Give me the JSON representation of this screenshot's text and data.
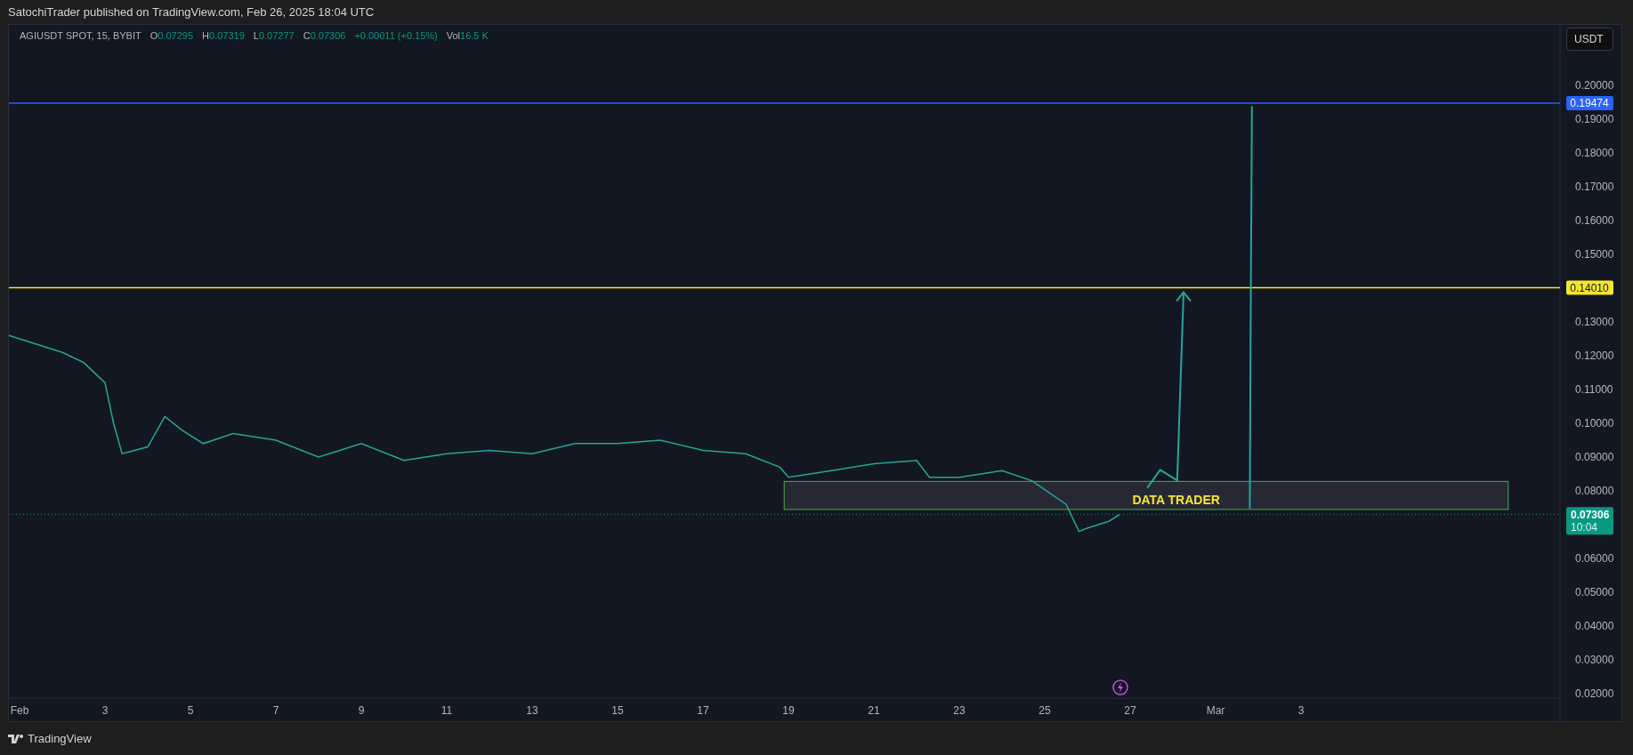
{
  "header": {
    "publish_note": "SatochiTrader published on TradingView.com, Feb 26, 2025 18:04 UTC"
  },
  "legend": {
    "symbol": "AGIUSDT SPOT, 15, BYBIT",
    "ohlc": [
      {
        "label": "O",
        "value": "0.07295"
      },
      {
        "label": "H",
        "value": "0.07319"
      },
      {
        "label": "L",
        "value": "0.07277"
      },
      {
        "label": "C",
        "value": "0.07306"
      }
    ],
    "change": "+0.00011 (+0.15%)",
    "volume": {
      "label": "Vol",
      "value": "16.5 K"
    }
  },
  "currency_button": "USDT",
  "chart": {
    "chart_data": {
      "type": "line",
      "x": [
        "2025-01-31T18:00",
        "2025-02-02T00:00",
        "2025-02-02T12:00",
        "2025-02-03T00:00",
        "2025-02-03T04:48",
        "2025-02-03T09:36",
        "2025-02-04T00:00",
        "2025-02-04T09:36",
        "2025-02-04T19:12",
        "2025-02-05T07:12",
        "2025-02-06T00:00",
        "2025-02-07T00:00",
        "2025-02-08T00:00",
        "2025-02-09T00:00",
        "2025-02-10T00:00",
        "2025-02-11T00:00",
        "2025-02-12T00:00",
        "2025-02-13T00:00",
        "2025-02-14T00:00",
        "2025-02-15T00:00",
        "2025-02-16T00:00",
        "2025-02-17T00:00",
        "2025-02-18T00:00",
        "2025-02-18T19:12",
        "2025-02-19T00:00",
        "2025-02-20T00:00",
        "2025-02-21T00:00",
        "2025-02-22T00:00",
        "2025-02-22T07:12",
        "2025-02-23T00:00",
        "2025-02-24T00:00",
        "2025-02-24T16:48",
        "2025-02-25T12:00",
        "2025-02-25T19:12",
        "2025-02-26T00:00",
        "2025-02-26T12:00",
        "2025-02-26T18:00"
      ],
      "series": [
        {
          "color": "#26a69a",
          "values": [
            0.126,
            0.121,
            0.118,
            0.112,
            0.1,
            0.091,
            0.093,
            0.102,
            0.098,
            0.094,
            0.097,
            0.095,
            0.09,
            0.094,
            0.089,
            0.091,
            0.092,
            0.091,
            0.094,
            0.094,
            0.095,
            0.092,
            0.091,
            0.087,
            0.084,
            0.086,
            0.088,
            0.089,
            0.084,
            0.084,
            0.086,
            0.083,
            0.076,
            0.068,
            0.069,
            0.071,
            0.073
          ]
        }
      ],
      "xlim": [
        "2025-01-31T18:00",
        "2025-03-09T00:00"
      ],
      "ylim": [
        0.01868,
        0.21789
      ],
      "xticks": [
        {
          "value": "2025-02-01T00:00",
          "label": "Feb"
        },
        {
          "value": "2025-02-03T00:00",
          "label": "3"
        },
        {
          "value": "2025-02-05T00:00",
          "label": "5"
        },
        {
          "value": "2025-02-07T00:00",
          "label": "7"
        },
        {
          "value": "2025-02-09T00:00",
          "label": "9"
        },
        {
          "value": "2025-02-11T00:00",
          "label": "11"
        },
        {
          "value": "2025-02-13T00:00",
          "label": "13"
        },
        {
          "value": "2025-02-15T00:00",
          "label": "15"
        },
        {
          "value": "2025-02-17T00:00",
          "label": "17"
        },
        {
          "value": "2025-02-19T00:00",
          "label": "19"
        },
        {
          "value": "2025-02-21T00:00",
          "label": "21"
        },
        {
          "value": "2025-02-23T00:00",
          "label": "23"
        },
        {
          "value": "2025-02-25T00:00",
          "label": "25"
        },
        {
          "value": "2025-02-27T00:00",
          "label": "27"
        },
        {
          "value": "2025-03-01T00:00",
          "label": "Mar"
        },
        {
          "value": "2025-03-03T00:00",
          "label": "3"
        }
      ],
      "yticks": [
        {
          "value": 0.02,
          "label": "0.02000"
        },
        {
          "value": 0.03,
          "label": "0.03000"
        },
        {
          "value": 0.04,
          "label": "0.04000"
        },
        {
          "value": 0.05,
          "label": "0.05000"
        },
        {
          "value": 0.06,
          "label": "0.06000"
        },
        {
          "value": 0.08,
          "label": "0.08000"
        },
        {
          "value": 0.09,
          "label": "0.09000"
        },
        {
          "value": 0.1,
          "label": "0.10000"
        },
        {
          "value": 0.11,
          "label": "0.11000"
        },
        {
          "value": 0.12,
          "label": "0.12000"
        },
        {
          "value": 0.13,
          "label": "0.13000"
        },
        {
          "value": 0.15,
          "label": "0.15000"
        },
        {
          "value": 0.16,
          "label": "0.16000"
        },
        {
          "value": 0.17,
          "label": "0.17000"
        },
        {
          "value": 0.18,
          "label": "0.18000"
        },
        {
          "value": 0.19,
          "label": "0.19000"
        },
        {
          "value": 0.2,
          "label": "0.20000"
        }
      ],
      "ref_lines": [
        {
          "axis": "y",
          "value": 0.19474,
          "label": "0.19474",
          "color": "#2962ff"
        },
        {
          "axis": "y",
          "value": 0.1401,
          "label": "0.14010",
          "color": "#f5e62e"
        },
        {
          "axis": "y",
          "value": 0.07306,
          "label": "0.07306",
          "color": "#089981"
        }
      ]
    },
    "zone": {
      "label": "DATA TRADER"
    },
    "last_price": {
      "countdown": "10:04"
    }
  },
  "footer": {
    "brand": "TradingView"
  }
}
